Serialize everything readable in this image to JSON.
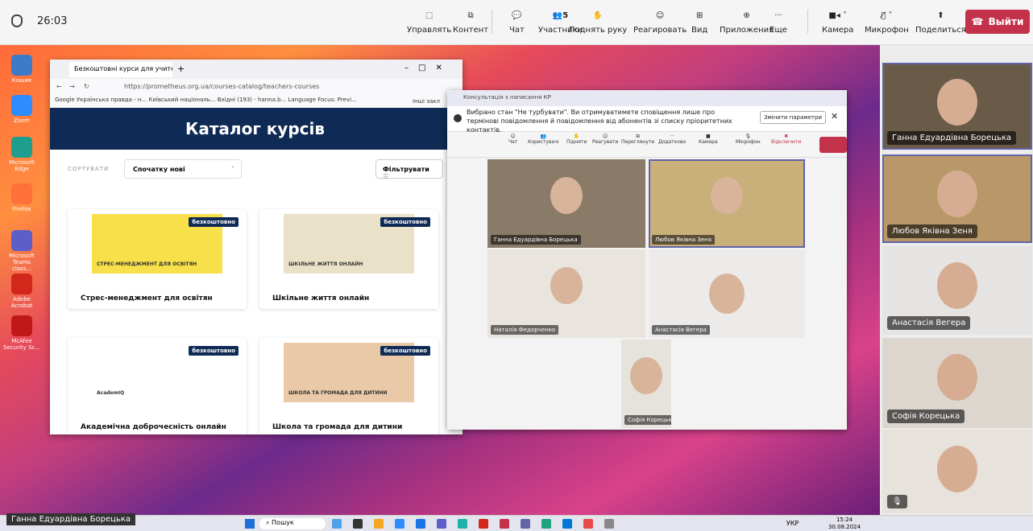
{
  "call": {
    "timer": "26:03"
  },
  "toolbar": {
    "control": "Управлять",
    "content": "Контент",
    "chat": "Чат",
    "participants": "Участники",
    "participants_count": "5",
    "raise_hand": "Поднять руку",
    "react": "Реагировать",
    "view": "Вид",
    "apps": "Приложения",
    "more": "Еще",
    "camera": "Камера",
    "microphone": "Микрофон",
    "share": "Поделиться",
    "leave": "Выйти"
  },
  "desktop_icons": [
    {
      "label": "Кошик",
      "color": "#3d7ac7"
    },
    {
      "label": "Zoom",
      "color": "#2d8cff"
    },
    {
      "label": "Microsoft Edge",
      "color": "#1f9e8f"
    },
    {
      "label": "Firefox",
      "color": "#ff7139"
    },
    {
      "label": "Microsoft Teams class...",
      "color": "#5b5fc7"
    },
    {
      "label": "Adobe Acrobat",
      "color": "#d4271b"
    },
    {
      "label": "McAfee Security Sc...",
      "color": "#c01818"
    }
  ],
  "browser": {
    "tab_title": "Безкоштовні курси для учите",
    "url": "https://prometheus.org.ua/courses-catalog/teachers-courses",
    "bookmarks": "Google  Українська правда - н...  Київський національ...  Вхідні (193) - hanna.b...  Language Focus: Previ...",
    "other_bookmarks": "Інші закл",
    "heading": "Каталог курсів",
    "sort_label": "СОРТУВАТИ",
    "sort_value": "Спочатку нові",
    "filter": "Фільтрувати",
    "badge": "безкоштовно",
    "courses": [
      {
        "title": "Стрес-менеджмент для освітян",
        "banner": "СТРЕС-МЕНЕДЖМЕНТ ДЛЯ ОСВІТЯН",
        "color": "#f7e04a"
      },
      {
        "title": "Шкільне життя онлайн",
        "banner": "ШКІЛЬНЕ ЖИТТЯ ОНЛАЙН",
        "color": "#e9e2c8"
      },
      {
        "title": "Академічна доброчесність онлайн",
        "banner": "AcademIQ",
        "color": "#ffffff"
      },
      {
        "title": "Школа та громада для дитини",
        "banner": "ШКОЛА ТА ГРОМАДА ДЛЯ ДИТИНИ",
        "color": "#e9c9a8"
      }
    ]
  },
  "meeting": {
    "title": "Консультація з написання КР",
    "notice": "Вибрано стан \"Не турбувати\". Ви отримуватимете сповіщення лише про термінові повідомлення й повідомлення від абонентів зі списку пріоритетних контактів.",
    "change_settings": "Змінити параметри",
    "bar": {
      "chat": "Чат",
      "users": "Користувачі",
      "raise": "Підняти",
      "react": "Реагувати",
      "view": "Переглянути",
      "add": "Додатково",
      "camera": "Камера",
      "mic": "Мікрофон",
      "disconnect": "Відключити"
    },
    "tiles": [
      {
        "name": "Ганна Едуардівна Борецька",
        "bg": "#8a7a68"
      },
      {
        "name": "Любов Яківна Зеня",
        "bg": "#c9b07a"
      },
      {
        "name": "Наталія Федорченко",
        "bg": "#e9e4de"
      },
      {
        "name": "Анастасія Вегера",
        "bg": "#ecebea"
      },
      {
        "name": "Софія Корецька",
        "bg": "#e6e2dc"
      }
    ]
  },
  "right_panel": [
    {
      "name": "Ганна Едуардівна Борецька",
      "bg": "#6a5a48"
    },
    {
      "name": "Любов Яківна Зеня",
      "bg": "#b89868"
    },
    {
      "name": "Анастасія Вегера",
      "bg": "#e6e4e2"
    },
    {
      "name": "Софія Корецька",
      "bg": "#dcd6cf"
    },
    {
      "name": "",
      "bg": "#e7e2dc"
    }
  ],
  "taskbar": {
    "active_name": "Ганна Едуардівна Борецька",
    "search": "Пошук",
    "lang": "УКР",
    "time": "15:24",
    "date": "30.08.2024"
  }
}
